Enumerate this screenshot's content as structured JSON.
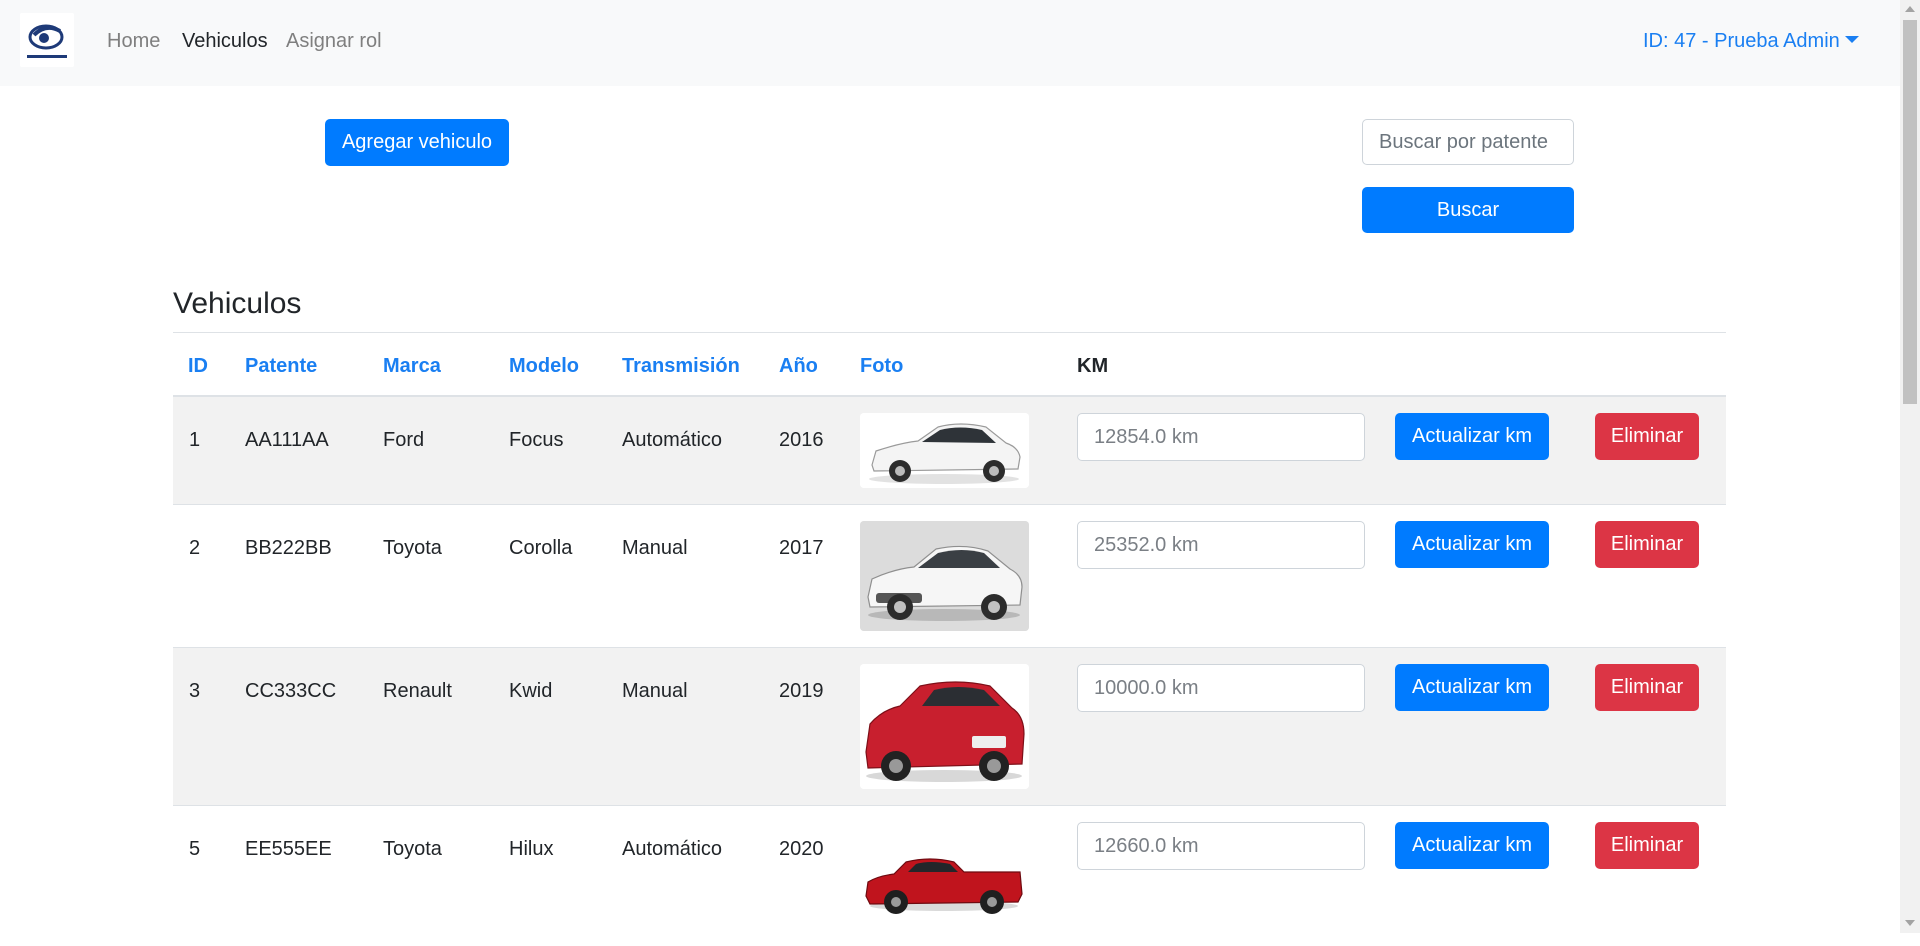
{
  "nav": {
    "links": [
      "Home",
      "Vehiculos",
      "Asignar rol"
    ],
    "user": "ID: 47 - Prueba Admin"
  },
  "actions": {
    "add_vehicle": "Agregar vehiculo",
    "search_placeholder": "Buscar por patente",
    "search_button": "Buscar"
  },
  "table": {
    "title": "Vehiculos",
    "headers": [
      "ID",
      "Patente",
      "Marca",
      "Modelo",
      "Transmisión",
      "Año",
      "Foto",
      "KM"
    ],
    "rows": [
      {
        "id": "1",
        "patente": "AA111AA",
        "marca": "Ford",
        "modelo": "Focus",
        "transmision": "Automático",
        "anio": "2016",
        "km_placeholder": "12854.0 km",
        "update_label": "Actualizar km",
        "delete_label": "Eliminar",
        "car_color": "#f4f4f4"
      },
      {
        "id": "2",
        "patente": "BB222BB",
        "marca": "Toyota",
        "modelo": "Corolla",
        "transmision": "Manual",
        "anio": "2017",
        "km_placeholder": "25352.0 km",
        "update_label": "Actualizar km",
        "delete_label": "Eliminar",
        "car_color": "#f6f6f6"
      },
      {
        "id": "3",
        "patente": "CC333CC",
        "marca": "Renault",
        "modelo": "Kwid",
        "transmision": "Manual",
        "anio": "2019",
        "km_placeholder": "10000.0 km",
        "update_label": "Actualizar km",
        "delete_label": "Eliminar",
        "car_color": "#c81f2e"
      },
      {
        "id": "5",
        "patente": "EE555EE",
        "marca": "Toyota",
        "modelo": "Hilux",
        "transmision": "Automático",
        "anio": "2020",
        "km_placeholder": "12660.0 km",
        "update_label": "Actualizar km",
        "delete_label": "Eliminar",
        "car_color": "#c0141d"
      }
    ]
  },
  "colors": {
    "primary": "#007bff",
    "danger": "#dc3545",
    "link": "#1a7ff2"
  }
}
